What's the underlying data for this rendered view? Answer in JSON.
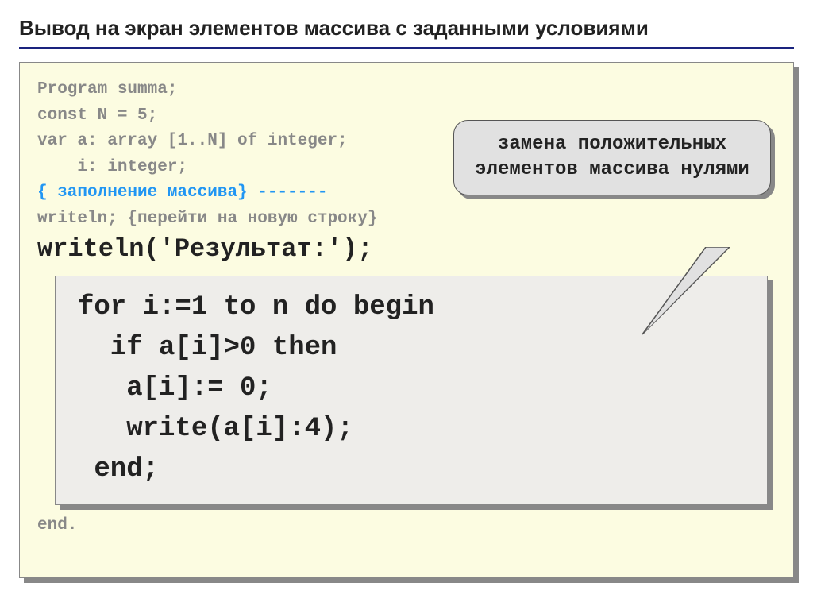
{
  "title": "Вывод на экран элементов массива с заданными условиями",
  "callout": "замена положительных элементов массива нулями",
  "code": {
    "l1": "Program summa;",
    "l2": "const N = 5;",
    "l3": "var a: array [1..N] of integer;",
    "l4": "    i: integer;",
    "l5": "{ заполнение массива} -------",
    "l6": "writeln; {перейти на новую строку}",
    "l7": "writeln('Результат:');",
    "end": "end."
  },
  "inner": {
    "l1": "for i:=1 to n do begin",
    "l2": "  if a[i]>0 then",
    "l3": "   a[i]:= 0;",
    "l4": "   write(a[i]:4);",
    "l5": " end;"
  }
}
